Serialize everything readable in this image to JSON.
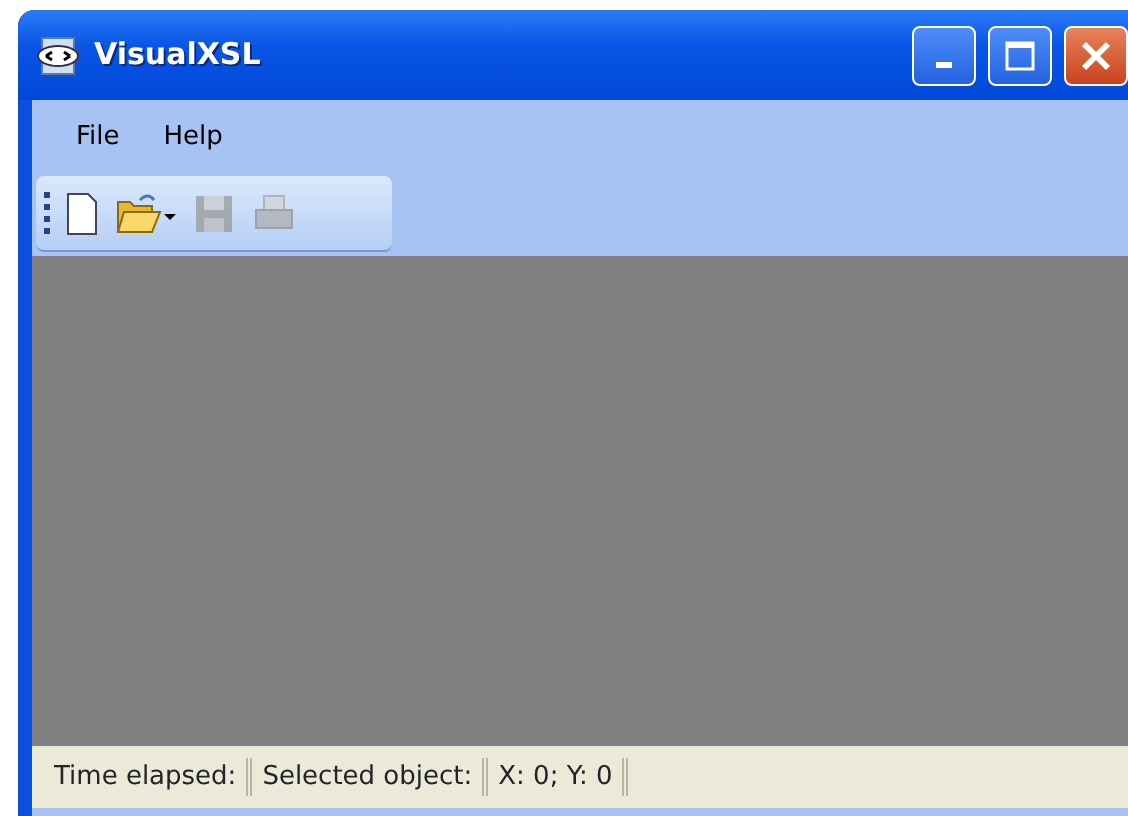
{
  "window": {
    "title": "VisualXSL"
  },
  "menu": [
    {
      "label": "File"
    },
    {
      "label": "Help"
    }
  ],
  "toolbar": [
    {
      "kind": "new",
      "disabled": false
    },
    {
      "kind": "open",
      "disabled": false
    },
    {
      "kind": "save",
      "disabled": true
    },
    {
      "kind": "print",
      "disabled": true
    }
  ],
  "status_bar": [
    {
      "text": "Time elapsed:"
    },
    {
      "text": "Selected object:"
    },
    {
      "text": "X: 0; Y: 0"
    }
  ]
}
